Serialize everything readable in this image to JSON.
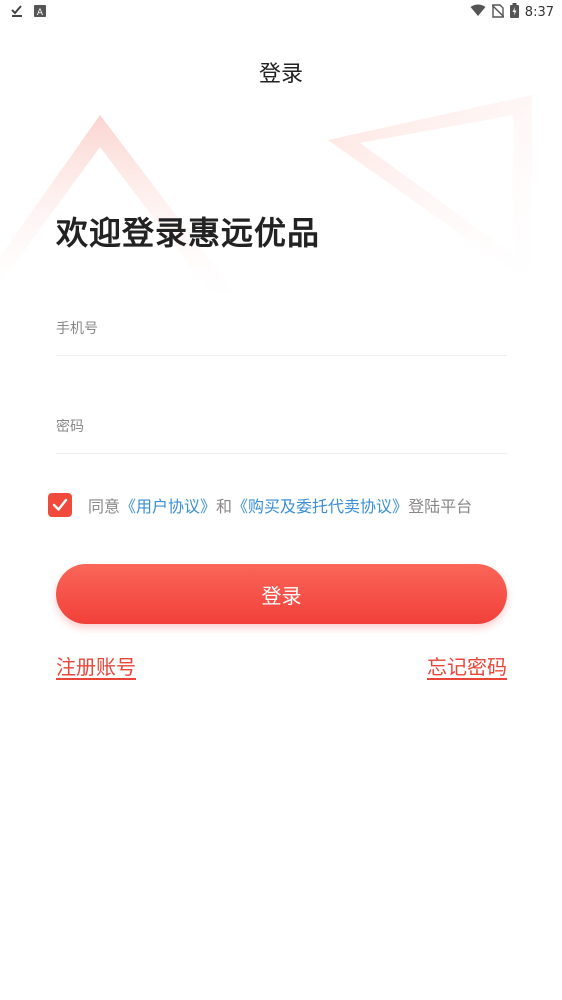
{
  "status_bar": {
    "time": "8:37",
    "icons": [
      "download-done-icon",
      "a-badge-icon",
      "wifi-icon",
      "no-sim-icon",
      "battery-charging-icon"
    ]
  },
  "nav": {
    "title": "登录"
  },
  "welcome": "欢迎登录惠远优品",
  "form": {
    "phone_placeholder": "手机号",
    "password_placeholder": "密码"
  },
  "agreement": {
    "checked": true,
    "prefix": "同意",
    "user_agreement": "《用户协议》",
    "and": "和",
    "purchase_agreement": "《购买及委托代卖协议》",
    "suffix": "登陆平台"
  },
  "login_button": "登录",
  "register_link": "注册账号",
  "forgot_link": "忘记密码",
  "colors": {
    "accent": "#f04a3c",
    "link_blue": "#3a8fd6",
    "decor": "#fde3e0"
  }
}
